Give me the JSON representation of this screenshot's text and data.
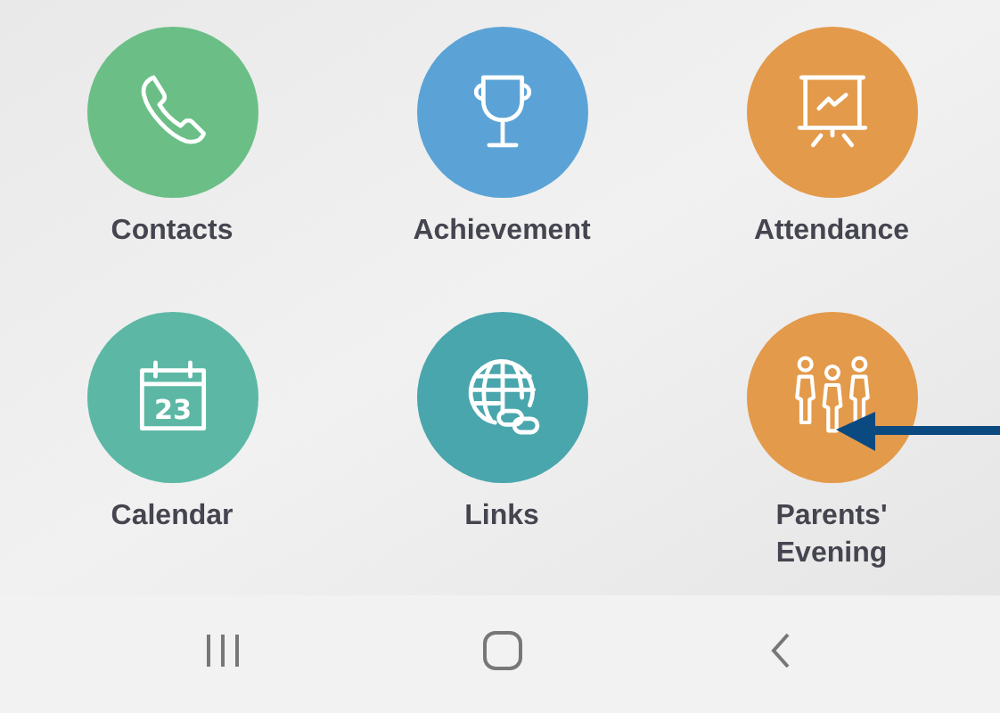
{
  "tiles": [
    {
      "kind": "phone",
      "label": "Contacts",
      "color": "#6bbf86",
      "arrow_pointing": false
    },
    {
      "kind": "trophy",
      "label": "Achievement",
      "color": "#5ba3d6",
      "arrow_pointing": false
    },
    {
      "kind": "presentation",
      "label": "Attendance",
      "color": "#e39a4a",
      "arrow_pointing": false
    },
    {
      "kind": "calendar",
      "label": "Calendar",
      "color": "#5cb8a4",
      "icon_text": "23",
      "arrow_pointing": false
    },
    {
      "kind": "globe-link",
      "label": "Links",
      "color": "#4aa6ad",
      "arrow_pointing": false
    },
    {
      "kind": "people",
      "label": "Parents' Evening",
      "color": "#e39a4a",
      "arrow_pointing": true
    }
  ],
  "nav_bar": [
    {
      "kind": "recents"
    },
    {
      "kind": "home"
    },
    {
      "kind": "back"
    }
  ]
}
